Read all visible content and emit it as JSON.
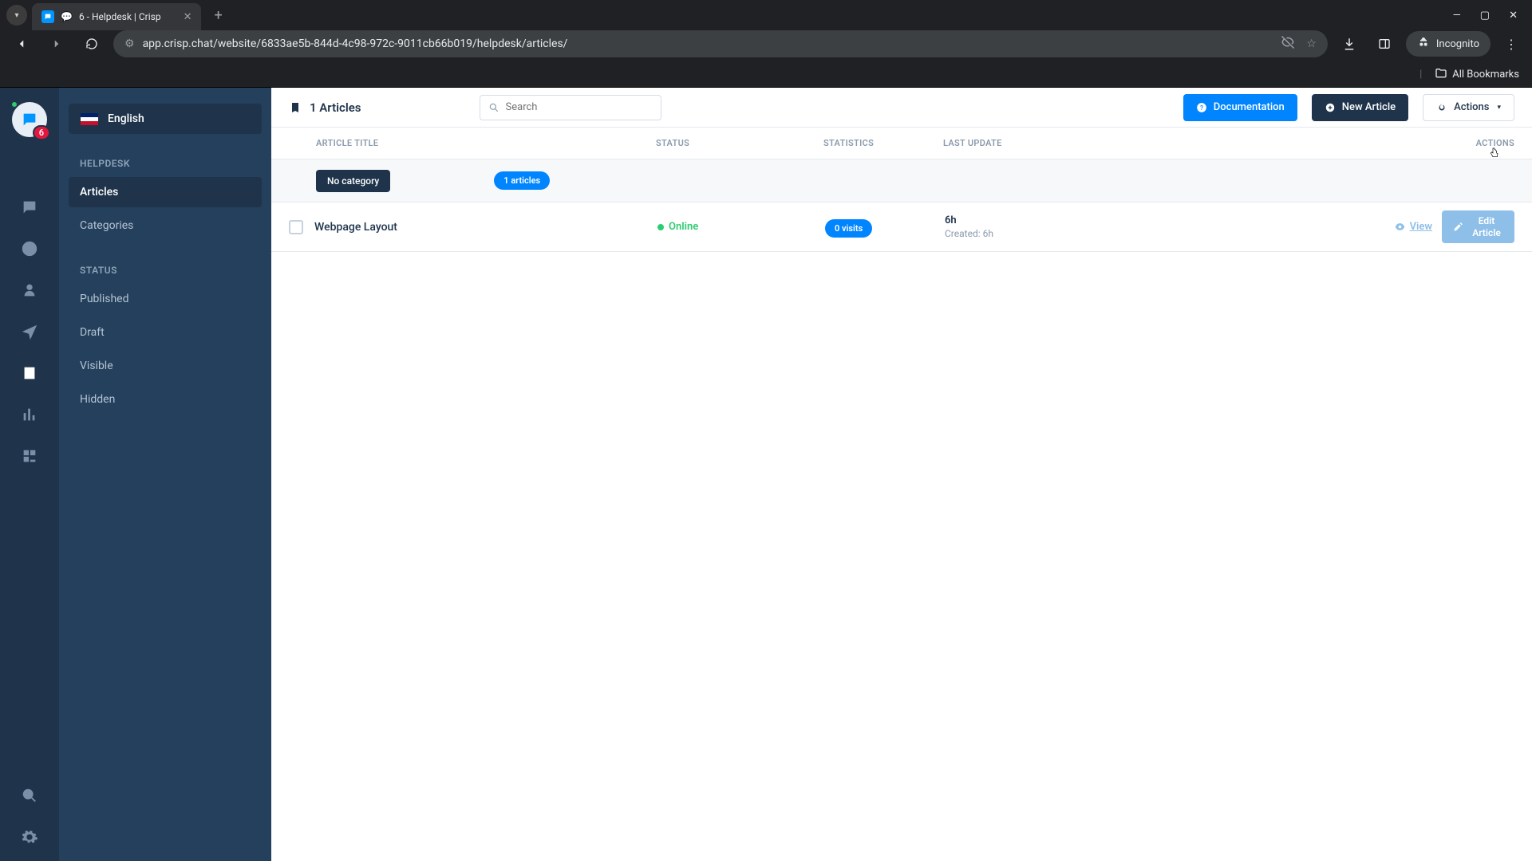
{
  "browser": {
    "tab_title": "6 - Helpdesk | Crisp",
    "url": "app.crisp.chat/website/6833ae5b-844d-4c98-972c-9011cb66b019/helpdesk/articles/",
    "incognito_label": "Incognito",
    "all_bookmarks": "All Bookmarks"
  },
  "rail": {
    "notification_count": "6"
  },
  "sidebar": {
    "language": "English",
    "heading_helpdesk": "HELPDESK",
    "item_articles": "Articles",
    "item_categories": "Categories",
    "heading_status": "STATUS",
    "item_published": "Published",
    "item_draft": "Draft",
    "item_visible": "Visible",
    "item_hidden": "Hidden"
  },
  "toolbar": {
    "count_label": "1 Articles",
    "search_placeholder": "Search",
    "documentation": "Documentation",
    "new_article": "New Article",
    "actions": "Actions"
  },
  "table": {
    "head_title": "ARTICLE TITLE",
    "head_status": "STATUS",
    "head_stats": "STATISTICS",
    "head_update": "LAST UPDATE",
    "head_actions": "ACTIONS",
    "category_label": "No category",
    "category_count": "1 articles",
    "row": {
      "title": "Webpage Layout",
      "status": "Online",
      "visits": "0 visits",
      "age": "6h",
      "created": "Created: 6h",
      "view": "View",
      "edit": "Edit Article"
    }
  }
}
